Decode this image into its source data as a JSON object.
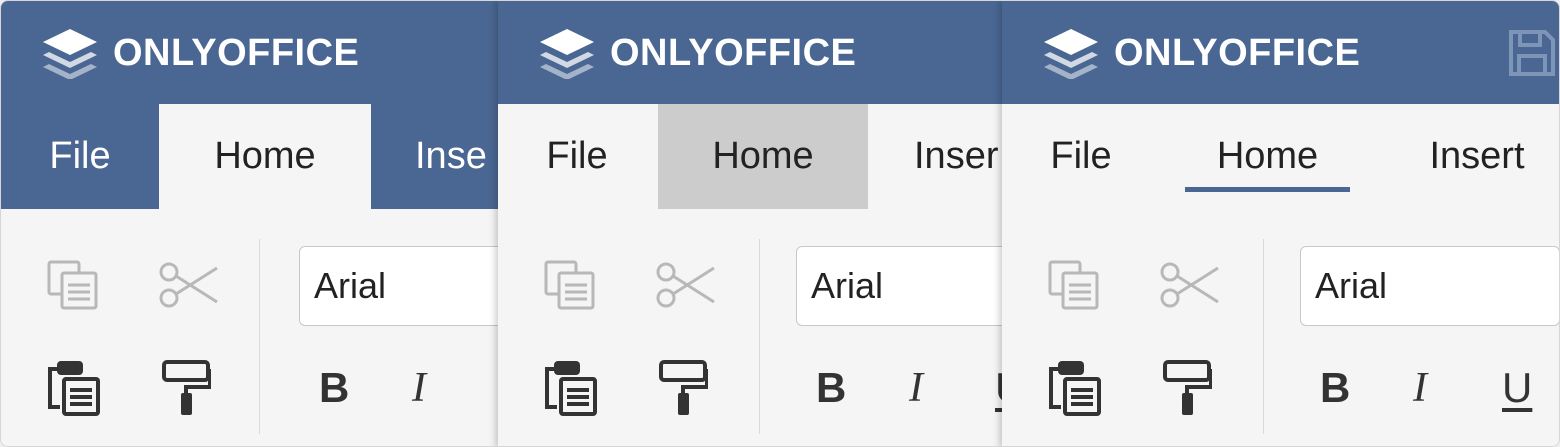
{
  "app": {
    "brand_name": "ONLYOFFICE",
    "logo_icon": "stacked-layers-icon",
    "save_icon": "floppy-disk-icon"
  },
  "colors": {
    "header": "#4a6793",
    "toolbar_bg": "#f5f5f5",
    "hover_tab": "#cccccc",
    "underline": "#4a6793"
  },
  "panels": [
    {
      "variant": "classic-active-tab",
      "tabs": [
        {
          "label": "File"
        },
        {
          "label": "Home",
          "active": true
        },
        {
          "label": "Inse"
        }
      ],
      "toolbar": {
        "font_name": "Arial",
        "bold": "B",
        "italic": "I",
        "underline": ""
      }
    },
    {
      "variant": "hover-tab",
      "tabs": [
        {
          "label": "File"
        },
        {
          "label": "Home",
          "active": true
        },
        {
          "label": "Inser"
        }
      ],
      "toolbar": {
        "font_name": "Arial",
        "bold": "B",
        "italic": "I",
        "underline": "U"
      }
    },
    {
      "variant": "underline-tab",
      "tabs": [
        {
          "label": "File"
        },
        {
          "label": "Home",
          "active": true
        },
        {
          "label": "Insert"
        }
      ],
      "toolbar": {
        "font_name": "Arial",
        "bold": "B",
        "italic": "I",
        "underline": "U"
      }
    }
  ],
  "icons": [
    "copy-icon",
    "cut-icon",
    "paste-icon",
    "format-painter-icon"
  ]
}
